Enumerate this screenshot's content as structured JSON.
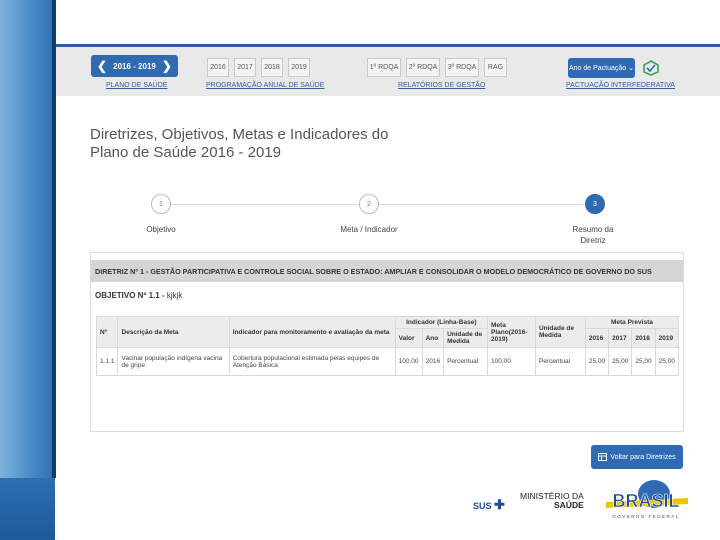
{
  "topbar": {
    "period": "2016 - 2019",
    "period_label": "PLANO DE SAÚDE",
    "years": [
      "2016",
      "2017",
      "2018",
      "2019"
    ],
    "years_label": "PROGRAMAÇÃO ANUAL DE SAÚDE",
    "reports": [
      "1º RDQA",
      "2º RDQA",
      "3º RDQA",
      "RAG"
    ],
    "reports_label": "RELATÓRIOS DE GESTÃO",
    "pactuacao_button": "Ano de Pactuação",
    "pactuacao_label": "PACTUAÇÃO INTERFEDERATIVA"
  },
  "page_title": "Diretrizes, Objetivos, Metas e Indicadores do Plano de Saúde 2016 - 2019",
  "steps": [
    {
      "number": "1",
      "label": "Objetivo"
    },
    {
      "number": "2",
      "label": "Meta / Indicador"
    },
    {
      "number": "3",
      "label": "Resumo da Diretriz"
    }
  ],
  "diretriz": "DIRETRIZ Nº 1 - GESTÃO PARTICIPATIVA E CONTROLE SOCIAL SOBRE O ESTADO: AMPLIAR E CONSOLIDAR O MODELO DEMOCRÁTICO DE GOVERNO DO SUS",
  "objetivo_prefix": "OBJETIVO Nº 1.1 -",
  "objetivo_text": "kjkjk",
  "table": {
    "group_headers": {
      "indicador": "Indicador (Linha-Base)",
      "meta_prevista": "Meta Prevista"
    },
    "headers": {
      "num": "Nº",
      "descricao": "Descrição da Meta",
      "indicador": "Indicador para monitoramento e avaliação da meta",
      "valor": "Valor",
      "ano": "Ano",
      "unidade1": "Unidade de Medida",
      "meta_plano": "Meta Plano(2016-2019)",
      "unidade2": "Unidade de Medida",
      "y2016": "2016",
      "y2017": "2017",
      "y2018": "2018",
      "y2019": "2019"
    },
    "rows": [
      {
        "num": "1.1.1",
        "descricao": "Vacinar população indígena vacina de gripe",
        "indicador": "Cobertura populacional estimada pelas equipes de Atenção Básica",
        "valor": "100,00",
        "ano": "2016",
        "unidade1": "Percentual",
        "meta_plano": "100,00",
        "unidade2": "Percentual",
        "y2016": "25,00",
        "y2017": "25,00",
        "y2018": "25,00",
        "y2019": "25,00"
      }
    ]
  },
  "back_button": "Voltar para Diretrizes",
  "footer": {
    "sus": "SUS",
    "ministerio_line1": "MINISTÉRIO DA",
    "ministerio_line2": "SAÚDE",
    "brasil": "BRASIL",
    "brasil_sub": "GOVERNO FEDERAL"
  }
}
